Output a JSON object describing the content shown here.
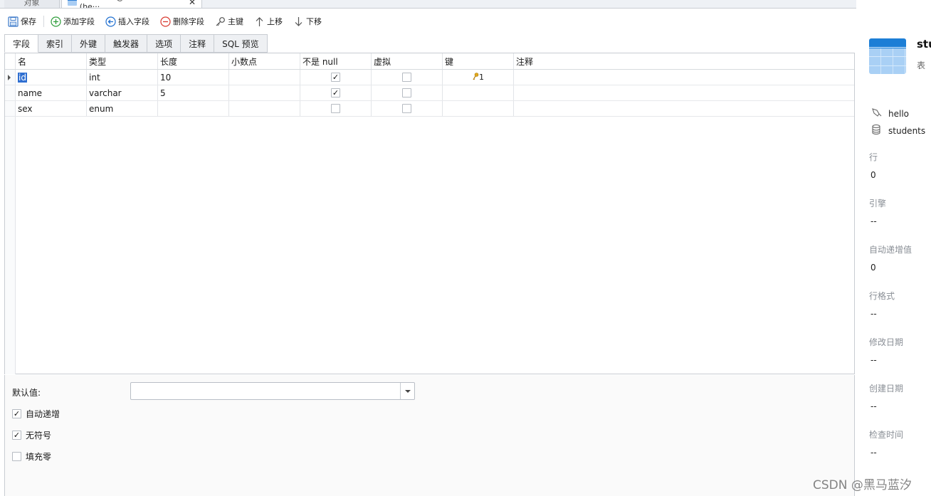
{
  "doc_tabs": {
    "objects_label": "对象",
    "active_label": "students @ students (he···",
    "close_glyph": "✕"
  },
  "toolbar": {
    "save": "保存",
    "add_field": "添加字段",
    "insert_field": "插入字段",
    "delete_field": "删除字段",
    "primary_key": "主键",
    "move_up": "上移",
    "move_down": "下移"
  },
  "sub_tabs": [
    "字段",
    "索引",
    "外键",
    "触发器",
    "选项",
    "注释",
    "SQL 预览"
  ],
  "active_sub_tab": "字段",
  "columns": [
    "名",
    "类型",
    "长度",
    "小数点",
    "不是 null",
    "虚拟",
    "键",
    "注释"
  ],
  "rows": [
    {
      "name": "id",
      "type": "int",
      "length": "10",
      "decimals": "",
      "not_null": true,
      "virtual": false,
      "key": "1",
      "comment": ""
    },
    {
      "name": "name",
      "type": "varchar",
      "length": "5",
      "decimals": "",
      "not_null": true,
      "virtual": false,
      "key": "",
      "comment": ""
    },
    {
      "name": "sex",
      "type": "enum",
      "length": "",
      "decimals": "",
      "not_null": false,
      "virtual": false,
      "key": "",
      "comment": ""
    }
  ],
  "props": {
    "default_label": "默认值:",
    "default_value": "",
    "auto_increment": {
      "label": "自动递增",
      "checked": true
    },
    "unsigned": {
      "label": "无符号",
      "checked": true
    },
    "zerofill": {
      "label": "填充零",
      "checked": false
    }
  },
  "info": {
    "title": "stu",
    "subtitle": "表",
    "connection": "hello",
    "database": "students",
    "fields": [
      {
        "key": "行",
        "value": "0"
      },
      {
        "key": "引擎",
        "value": "--"
      },
      {
        "key": "自动递增值",
        "value": "0"
      },
      {
        "key": "行格式",
        "value": "--"
      },
      {
        "key": "修改日期",
        "value": "--"
      },
      {
        "key": "创建日期",
        "value": "--"
      },
      {
        "key": "检查时间",
        "value": "--"
      }
    ]
  },
  "watermark": "CSDN @黑马蓝汐",
  "colors": {
    "accent": "#2f6fd1",
    "add_green": "#2e9d3a",
    "delete_red": "#d9392f",
    "nav_blue": "#1f6fd0",
    "key_gold": "#d9a31a"
  }
}
